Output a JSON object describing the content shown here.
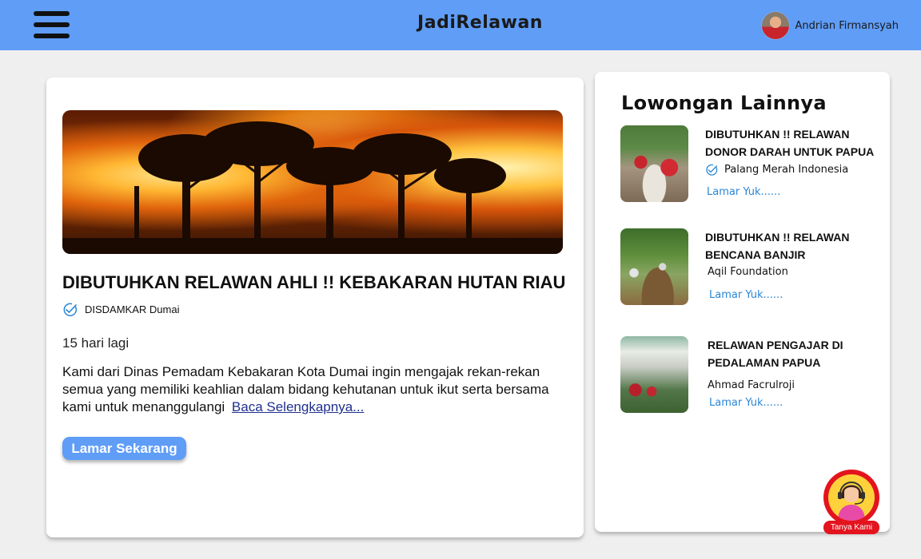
{
  "header": {
    "brand": "JadiRelawan",
    "user_name": "Andrian Firmansyah",
    "brand_color": "#5f9df7"
  },
  "main": {
    "title": "DIBUTUHKAN RELAWAN AHLI !! KEBAKARAN HUTAN RIAU",
    "organization": "DISDAMKAR Dumai",
    "deadline": "15 hari lagi",
    "description": "Kami dari Dinas Pemadam Kebakaran Kota Dumai ingin mengajak rekan-rekan semua yang memiliki keahlian dalam bidang kehutanan untuk ikut serta bersama kami untuk menanggulangi",
    "read_more": "Baca Selengkapnya...",
    "apply_label": "Lamar Sekarang"
  },
  "sidebar": {
    "title": "Lowongan Lainnya",
    "items": [
      {
        "title": "DIBUTUHKAN !! RELAWAN DONOR DARAH UNTUK PAPUA",
        "organization": "Palang Merah Indonesia",
        "verified": true,
        "link": "Lamar Yuk......"
      },
      {
        "title": "DIBUTUHKAN !! RELAWAN BENCANA BANJIR",
        "organization": "Aqil Foundation",
        "verified": false,
        "link": "Lamar Yuk......"
      },
      {
        "title": "RELAWAN PENGAJAR DI PEDALAMAN PAPUA",
        "organization": "Ahmad Facrulroji",
        "verified": false,
        "link": "Lamar Yuk......"
      }
    ]
  },
  "help": {
    "label": "Tanya Kami"
  }
}
